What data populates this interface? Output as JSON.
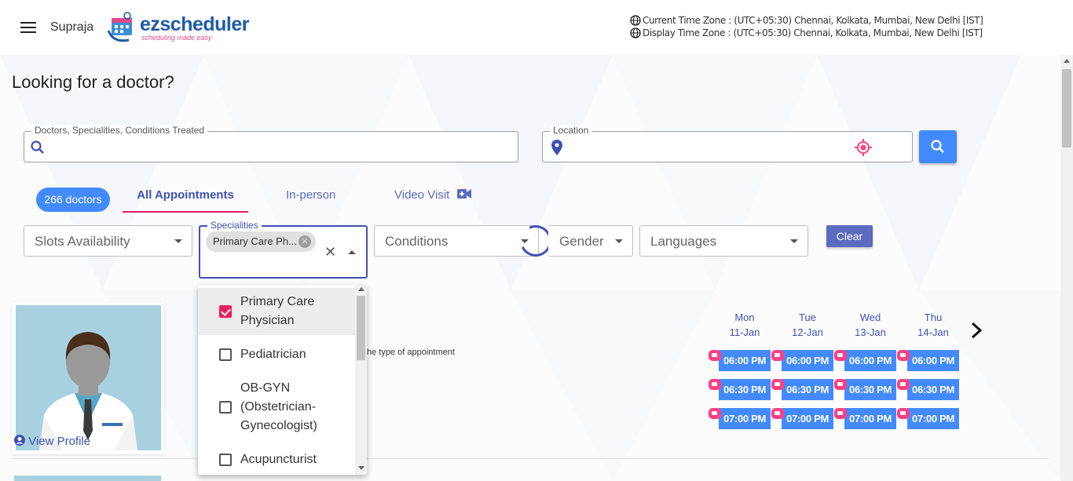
{
  "header": {
    "username": "Supraja",
    "logo_text": "ezscheduler",
    "logo_tagline": "scheduling made easy",
    "current_tz": "Current Time Zone : (UTC+05:30) Chennai, Kolkata, Mumbai, New Delhi [IST]",
    "display_tz": "Display Time Zone : (UTC+05:30) Chennai, Kolkata, Mumbai, New Delhi [IST]"
  },
  "page": {
    "title": "Looking for a doctor?"
  },
  "search": {
    "doctor_label": "Doctors, Specialities, Conditions Treated",
    "location_label": "Location"
  },
  "tabs": {
    "count": "266 doctors",
    "all": "All Appointments",
    "inperson": "In-person",
    "video": "Video Visit"
  },
  "filters": {
    "slots": "Slots Availability",
    "specialities_label": "Specialities",
    "specialities_chip": "Primary Care Ph...",
    "conditions": "Conditions",
    "gender": "Gender",
    "languages": "Languages",
    "clear": "Clear"
  },
  "dropdown": {
    "options": [
      {
        "label": "Primary Care Physician",
        "checked": true
      },
      {
        "label": "Pediatrician",
        "checked": false
      },
      {
        "label": "OB-GYN (Obstetrician-Gynecologist)",
        "checked": false
      },
      {
        "label": "Acupuncturist",
        "checked": false
      }
    ]
  },
  "doctor": {
    "view_profile": "View Profile",
    "appt_text": "he type of appointment"
  },
  "schedule": {
    "days": [
      {
        "dow": "Mon",
        "date": "11-Jan"
      },
      {
        "dow": "Tue",
        "date": "12-Jan"
      },
      {
        "dow": "Wed",
        "date": "13-Jan"
      },
      {
        "dow": "Thu",
        "date": "14-Jan"
      }
    ],
    "times": [
      "06:00 PM",
      "06:30 PM",
      "07:00 PM"
    ]
  },
  "colors": {
    "primary": "#448aff",
    "indigo": "#3f51b5",
    "pink": "#e91e63"
  }
}
